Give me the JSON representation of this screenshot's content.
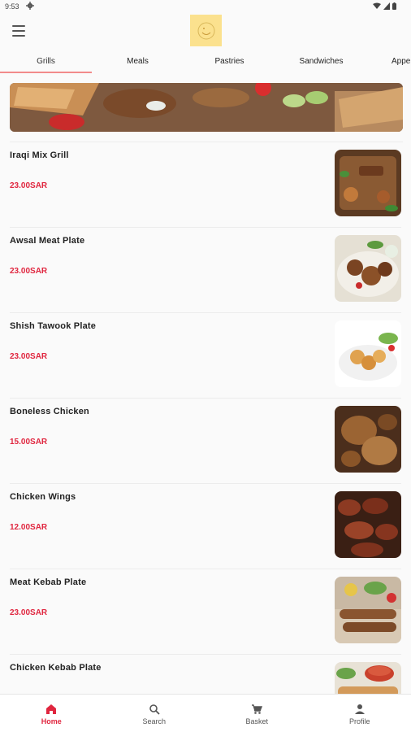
{
  "status_bar": {
    "time": "9:53",
    "gear_icon": "gear-icon",
    "right_icons": [
      "wifi-icon",
      "signal-icon",
      "battery-icon"
    ]
  },
  "app_bar": {
    "menu_icon": "hamburger-menu-icon",
    "logo": "restaurant-logo"
  },
  "tabs": [
    {
      "label": "Grills",
      "active": true
    },
    {
      "label": "Meals",
      "active": false
    },
    {
      "label": "Pastries",
      "active": false
    },
    {
      "label": "Sandwiches",
      "active": false
    },
    {
      "label": "Appe",
      "active": false
    }
  ],
  "menu_items": [
    {
      "name": "Iraqi Mix Grill",
      "price": "23.00SAR"
    },
    {
      "name": "Awsal Meat Plate",
      "price": "23.00SAR"
    },
    {
      "name": "Shish Tawook Plate",
      "price": "23.00SAR"
    },
    {
      "name": "Boneless Chicken",
      "price": "15.00SAR"
    },
    {
      "name": "Chicken Wings",
      "price": "12.00SAR"
    },
    {
      "name": "Meat Kebab Plate",
      "price": "23.00SAR"
    },
    {
      "name": "Chicken Kebab Plate",
      "price": ""
    }
  ],
  "bottom_nav": [
    {
      "label": "Home",
      "icon": "home-icon",
      "active": true
    },
    {
      "label": "Search",
      "icon": "search-icon",
      "active": false
    },
    {
      "label": "Basket",
      "icon": "cart-icon",
      "active": false
    },
    {
      "label": "Profile",
      "icon": "profile-icon",
      "active": false
    }
  ],
  "colors": {
    "accent": "#e0263f",
    "tab_indicator": "#f28b8b",
    "logo_bg": "#fbe18e"
  }
}
